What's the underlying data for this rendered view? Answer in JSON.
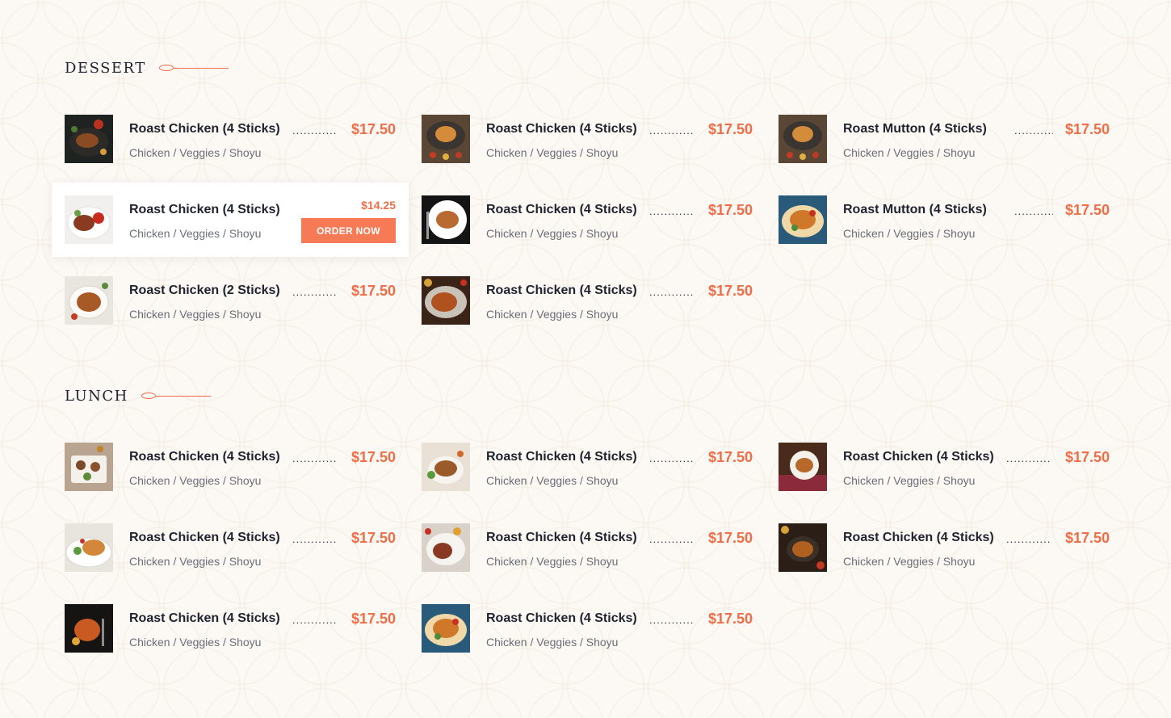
{
  "sections": [
    {
      "title": "DESSERT",
      "columns": [
        [
          {
            "name": "Roast Chicken (4 Sticks)",
            "desc": "Chicken / Veggies / Shoyu",
            "price": "$17.50",
            "dots": "............"
          },
          {
            "name": "Roast Chicken (4 Sticks)",
            "desc": "Chicken / Veggies / Shoyu",
            "price": "$14.25",
            "button": "ORDER NOW"
          },
          {
            "name": "Roast Chicken (2 Sticks)",
            "desc": "Chicken / Veggies / Shoyu",
            "price": "$17.50",
            "dots": "............"
          }
        ],
        [
          {
            "name": "Roast Chicken (4 Sticks)",
            "desc": "Chicken / Veggies / Shoyu",
            "price": "$17.50",
            "dots": "............"
          },
          {
            "name": "Roast Chicken (4 Sticks)",
            "desc": "Chicken / Veggies / Shoyu",
            "price": "$17.50",
            "dots": "............"
          },
          {
            "name": "Roast Chicken (4 Sticks)",
            "desc": "Chicken / Veggies / Shoyu",
            "price": "$17.50",
            "dots": "............"
          }
        ],
        [
          {
            "name": "Roast Mutton (4 Sticks)",
            "desc": "Chicken / Veggies / Shoyu",
            "price": "$17.50",
            "dots": "............"
          },
          {
            "name": "Roast Mutton (4 Sticks)",
            "desc": "Chicken / Veggies / Shoyu",
            "price": "$17.50",
            "dots": "..........."
          }
        ]
      ]
    },
    {
      "title": "LUNCH",
      "columns": [
        [
          {
            "name": "Roast Chicken (4 Sticks)",
            "desc": "Chicken / Veggies / Shoyu",
            "price": "$17.50",
            "dots": "............"
          },
          {
            "name": "Roast Chicken (4 Sticks)",
            "desc": "Chicken / Veggies / Shoyu",
            "price": "$17.50",
            "dots": "............"
          },
          {
            "name": "Roast Chicken (4 Sticks)",
            "desc": "Chicken / Veggies / Shoyu",
            "price": "$17.50",
            "dots": "............"
          }
        ],
        [
          {
            "name": "Roast Chicken (4 Sticks)",
            "desc": "Chicken / Veggies / Shoyu",
            "price": "$17.50",
            "dots": "............"
          },
          {
            "name": "Roast Chicken (4 Sticks)",
            "desc": "Chicken / Veggies / Shoyu",
            "price": "$17.50",
            "dots": "............"
          },
          {
            "name": "Roast Chicken (4 Sticks)",
            "desc": "Chicken / Veggies / Shoyu",
            "price": "$17.50",
            "dots": "............"
          }
        ],
        [
          {
            "name": "Roast Chicken (4 Sticks)",
            "desc": "Chicken / Veggies / Shoyu",
            "price": "$17.50",
            "dots": "............"
          },
          {
            "name": "Roast Chicken (4 Sticks)",
            "desc": "Chicken / Veggies / Shoyu",
            "price": "$17.50",
            "dots": "............"
          }
        ]
      ]
    }
  ],
  "colors": {
    "accent": "#ef6d47",
    "button": "#f57a55",
    "text": "#1f2330",
    "muted": "#6b6e78",
    "background": "#fcf8f3"
  }
}
